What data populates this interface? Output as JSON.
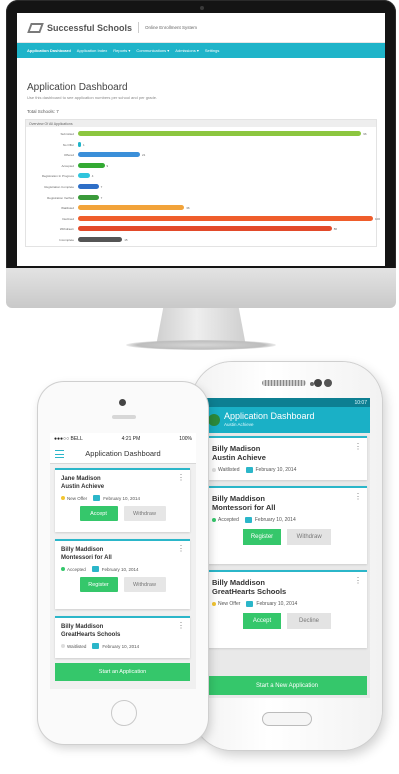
{
  "desktop": {
    "brand": "Successful Schools",
    "subtitle": "Online Enrollment System",
    "nav": [
      "Application Dashboard",
      "Application Index",
      "Reports ▾",
      "Communications ▾",
      "Admissions ▾",
      "Settings"
    ],
    "page_title": "Application Dashboard",
    "page_desc": "Use this dashboard to see application numbers per school and per grade.",
    "total": "Total Schools: 7",
    "panel_title": "Overview Of All Applications"
  },
  "chart_data": {
    "type": "bar",
    "orientation": "horizontal",
    "categories": [
      "Submitted",
      "No Offer",
      "Offered",
      "Accepted",
      "Registration In Progress",
      "Registration Complete",
      "Registration Verified",
      "Waitlisted",
      "Declined",
      "Withdrawn",
      "Incomplete"
    ],
    "values": [
      96,
      1,
      21,
      9,
      4,
      7,
      7,
      36,
      100,
      86,
      15
    ],
    "value_labels": [
      "96",
      "1",
      "21",
      "9",
      "4",
      "7",
      "7",
      "36",
      "100",
      "86",
      "15"
    ],
    "colors": [
      "#8cc63f",
      "#1fb4c9",
      "#3b8fd9",
      "#33aa33",
      "#30c5dd",
      "#2f6fc7",
      "#3a9a3a",
      "#f2a33a",
      "#ef5d2b",
      "#e24a2a",
      "#555555"
    ],
    "xlim": [
      0,
      100
    ],
    "grid": false,
    "legend": "none"
  },
  "iphone": {
    "carrier": "●●●○○ BELL ",
    "time": "4:21 PM",
    "battery": "100%",
    "title": "Application Dashboard",
    "cards": [
      {
        "name": "Jane Madison",
        "school": "Austin Achieve",
        "status": "New Offer",
        "status_color": "#f2c531",
        "date": "February 10, 2014",
        "primary": "Accept",
        "secondary": "Withdraw"
      },
      {
        "name": "Billy Maddison",
        "school": "Montessori for All",
        "status": "Accepted",
        "status_color": "#35c76b",
        "date": "February 10, 2014",
        "primary": "Register",
        "secondary": "Withdraw"
      },
      {
        "name": "Billy Maddison",
        "school": "GreatHearts Schools",
        "status": "Waitlisted",
        "status_color": "#dddddd",
        "date": "February 10, 2014"
      }
    ],
    "start_button": "Start an Application"
  },
  "samsung": {
    "time": "10:07",
    "title": "Application Dashboard",
    "subtitle": "Austin Achieve",
    "cards": [
      {
        "name": "Billy Madison",
        "school": "Austin Achieve",
        "status": "Waitlisted",
        "status_color": "#dddddd",
        "date": "February 10, 2014"
      },
      {
        "name": "Billy Maddison",
        "school": "Montessori for All",
        "status": "Accepted",
        "status_color": "#35c76b",
        "date": "February 10, 2014",
        "primary": "Register",
        "secondary": "Withdraw"
      },
      {
        "name": "Billy Maddison",
        "school": "GreatHearts Schools",
        "status": "New Offer",
        "status_color": "#f2c531",
        "date": "February 10, 2014",
        "primary": "Accept",
        "secondary": "Decline"
      }
    ],
    "start_button": "Start a New Application"
  }
}
